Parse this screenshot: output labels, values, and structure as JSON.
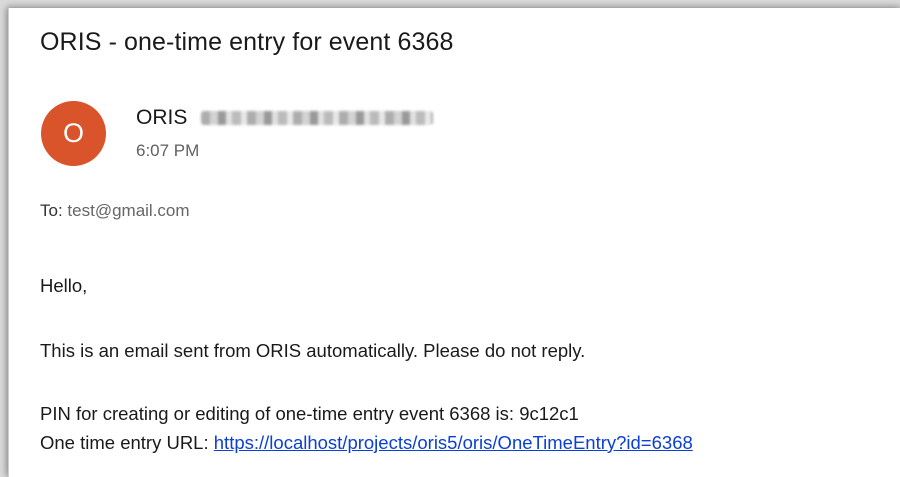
{
  "email": {
    "subject": "ORIS - one-time entry for event 6368",
    "avatar_initial": "O",
    "sender_name": "ORIS",
    "time": "6:07 PM",
    "to_label": "To:",
    "to_address": "test@gmail.com",
    "body": {
      "greeting": "Hello,",
      "notice": "This is an email sent from ORIS automatically. Please do not reply.",
      "pin_line": "PIN for creating or editing of one-time entry event 6368 is: 9c12c1",
      "url_label": "One time entry URL:",
      "url": "https://localhost/projects/oris5/oris/OneTimeEntry?id=6368"
    }
  },
  "colors": {
    "avatar_bg": "#d9542b",
    "link": "#0b3fd6"
  }
}
